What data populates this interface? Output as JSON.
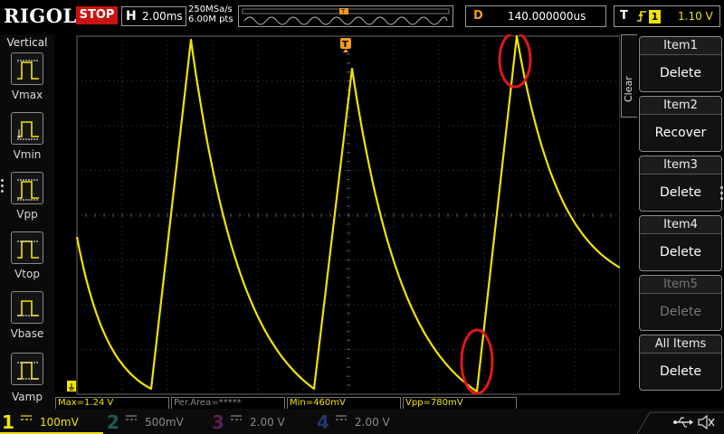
{
  "header": {
    "brand": "RIGOL",
    "run_state": "STOP",
    "horizontal_label": "H",
    "timebase": "2.00ms",
    "sample_rate": "250MSa/s",
    "memory_depth": "6.00M pts",
    "trigger_marker": "T",
    "delay_label": "D",
    "delay_value": "140.000000us",
    "trigger_label": "T",
    "trigger_edge": "rising-edge-icon",
    "trigger_source": "1",
    "trigger_level": "1.10 V"
  },
  "left_panel": {
    "title": "Vertical",
    "items": [
      {
        "label": "Vmax",
        "icon": "vmax-icon"
      },
      {
        "label": "Vmin",
        "icon": "vmin-icon"
      },
      {
        "label": "Vpp",
        "icon": "vpp-icon"
      },
      {
        "label": "Vtop",
        "icon": "vtop-icon"
      },
      {
        "label": "Vbase",
        "icon": "vbase-icon"
      },
      {
        "label": "Vamp",
        "icon": "vamp-icon"
      }
    ]
  },
  "right_menu": {
    "clear_label": "Clear",
    "items": [
      {
        "title": "Item1",
        "action": "Delete",
        "enabled": true
      },
      {
        "title": "Item2",
        "action": "Recover",
        "enabled": true
      },
      {
        "title": "Item3",
        "action": "Delete",
        "enabled": true
      },
      {
        "title": "Item4",
        "action": "Delete",
        "enabled": true
      },
      {
        "title": "Item5",
        "action": "Delete",
        "enabled": false
      },
      {
        "title": "All Items",
        "action": "Delete",
        "enabled": true
      }
    ]
  },
  "measurements": [
    {
      "text": "Max=1.24 V",
      "active": true
    },
    {
      "text": "Per.Area=*****",
      "active": false
    },
    {
      "text": "Min=460mV",
      "active": true
    },
    {
      "text": "Vpp=780mV",
      "active": true
    }
  ],
  "channels": [
    {
      "number": "1",
      "scale": "100mV",
      "coupling": "DC",
      "active": true
    },
    {
      "number": "2",
      "scale": "500mV",
      "coupling": "DC",
      "active": false
    },
    {
      "number": "3",
      "scale": "2.00 V",
      "coupling": "DC",
      "active": false
    },
    {
      "number": "4",
      "scale": "2.00 V",
      "coupling": "DC",
      "active": false
    }
  ],
  "colors": {
    "ch1": "#f2e300",
    "ch2": "#1d5a58",
    "ch3": "#5a1f55",
    "ch4": "#1f3a6a",
    "stop": "#c8140f",
    "trigger_marker": "#f39c22",
    "annotation": "#e01818"
  },
  "waveform": {
    "channel": "1",
    "shape": "sawtooth-exponential-decay",
    "max_v": 1.24,
    "min_v": 0.46,
    "vpp_v": 0.78
  },
  "status_icons": [
    "usb-icon",
    "speaker-muted-icon"
  ]
}
